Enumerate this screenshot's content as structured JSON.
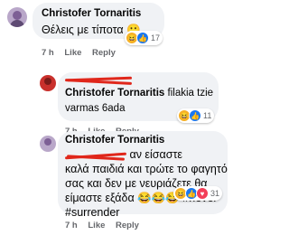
{
  "comments": [
    {
      "author": "Christofer Tornaritis",
      "text": "Θέλεις με τίποτα 🙂",
      "reaction_count": "17",
      "time": "7 h",
      "like": "Like",
      "reply": "Reply"
    },
    {
      "author": "Christofer Tornaritis",
      "text_line1": "filakia tzie",
      "text_line2": "varmas 6ada",
      "reaction_count": "11",
      "time": "7 h",
      "like": "Like",
      "reply": "Reply"
    },
    {
      "author": "Christofer Tornaritis",
      "text_line1": "αν είσαστε",
      "text_line2": "καλά παιδιά και τρώτε το φαγητό",
      "text_line3": "σας και δεν με νευριάζετε θα",
      "text_line4": "είμαστε εξάδα 😂😂😂 #never",
      "text_line5": "#surrender",
      "reaction_count": "31",
      "time": "7 h",
      "like": "Like",
      "reply": "Reply"
    }
  ],
  "colors": {
    "bubble": "#f0f2f5",
    "meta": "#65676b",
    "redact": "#e0271b",
    "like_blue": "#1877f2",
    "haha_yellow": "#f7b125",
    "love_red": "#f33e58"
  }
}
